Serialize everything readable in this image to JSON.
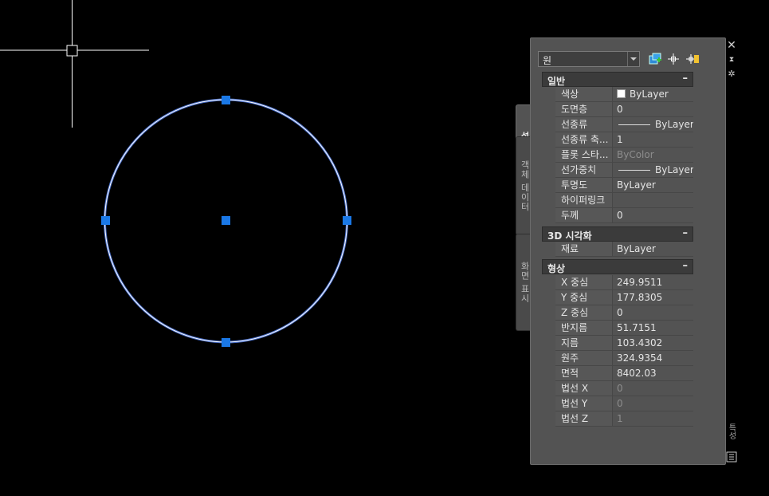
{
  "palette": {
    "object_type": "원",
    "side_tabs": [
      "설계",
      "객체 데이터",
      "화면 표시"
    ],
    "strip_title": "특성",
    "sections": [
      {
        "title": "일반",
        "toggle": "–",
        "rows": [
          {
            "name": "색상",
            "value": "ByLayer",
            "swatch": true
          },
          {
            "name": "도면층",
            "value": "0"
          },
          {
            "name": "선종류",
            "value": "ByLayer",
            "linetype": true
          },
          {
            "name": "선종류 축...",
            "value": "1"
          },
          {
            "name": "플롯 스타...",
            "value": "ByColor",
            "dim": true
          },
          {
            "name": "선가중치",
            "value": "ByLayer",
            "linetype": true
          },
          {
            "name": "투명도",
            "value": "ByLayer"
          },
          {
            "name": "하이퍼링크",
            "value": ""
          },
          {
            "name": "두께",
            "value": "0"
          }
        ]
      },
      {
        "title": "3D 시각화",
        "toggle": "–",
        "rows": [
          {
            "name": "재료",
            "value": "ByLayer"
          }
        ]
      },
      {
        "title": "형상",
        "toggle": "–",
        "rows": [
          {
            "name": "X 중심",
            "value": "249.9511"
          },
          {
            "name": "Y 중심",
            "value": "177.8305"
          },
          {
            "name": "Z 중심",
            "value": "0"
          },
          {
            "name": "반지름",
            "value": "51.7151"
          },
          {
            "name": "지름",
            "value": "103.4302"
          },
          {
            "name": "원주",
            "value": "324.9354"
          },
          {
            "name": "면적",
            "value": "8402.03"
          },
          {
            "name": "법선 X",
            "value": "0",
            "dim": true
          },
          {
            "name": "법선 Y",
            "value": "0",
            "dim": true
          },
          {
            "name": "법선 Z",
            "value": "1",
            "dim": true
          }
        ]
      }
    ],
    "icons": {
      "close": "close-icon",
      "autohide": "autohide-icon",
      "settings": "settings-icon",
      "quick_select": "quick-select-icon",
      "select_objects": "select-objects-icon",
      "toggle_pickadd": "toggle-pickadd-icon",
      "properties_corner": "properties-corner-icon"
    }
  },
  "colors": {
    "background": "#000000",
    "grip": "#1a78e6",
    "circle_highlight": "#5a7fd6",
    "crosshair": "#ffffff",
    "palette_bg": "#535353"
  }
}
